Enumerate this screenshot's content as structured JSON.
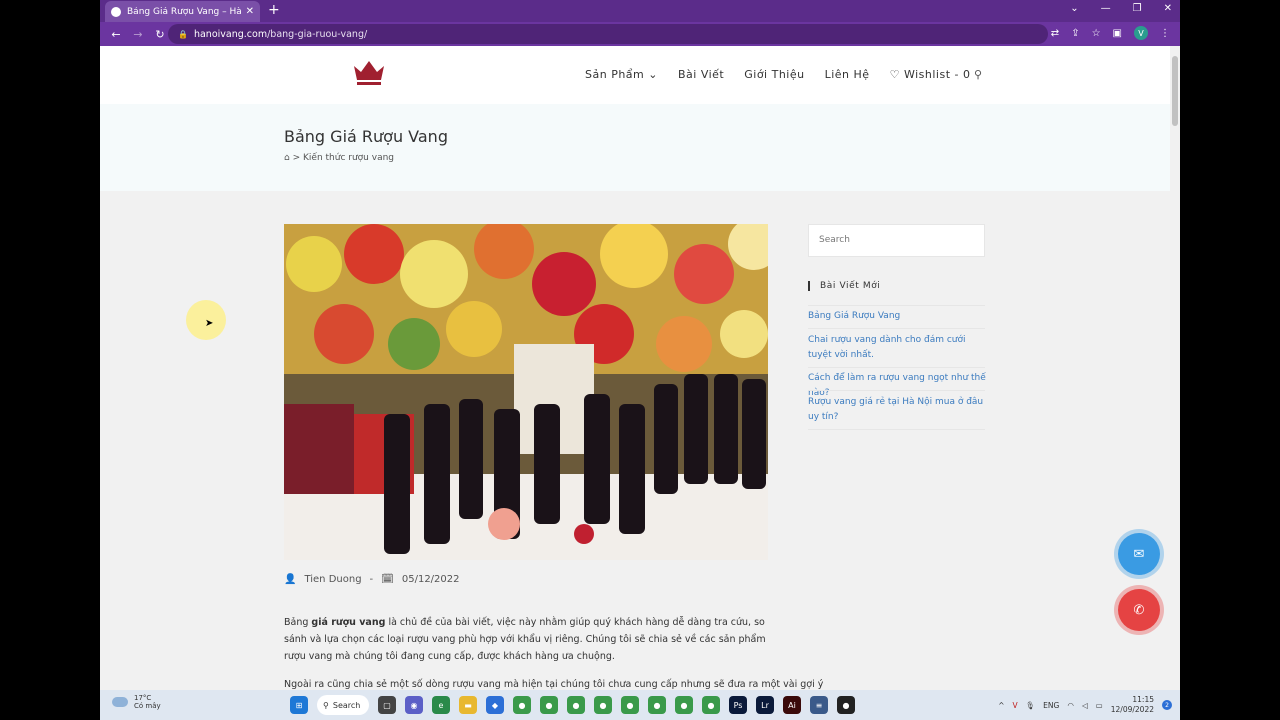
{
  "browser": {
    "tab_title": "Bảng Giá Rượu Vang – Hà Nội Vang",
    "url_host": "hanoivang.com",
    "url_path": "/bang-gia-ruou-vang/",
    "profile_initial": "V"
  },
  "nav": {
    "products": "Sản Phẩm",
    "posts": "Bài Viết",
    "about": "Giới Thiệu",
    "contact": "Liên Hệ",
    "wishlist": "Wishlist - 0"
  },
  "page": {
    "title": "Bảng Giá Rượu Vang",
    "breadcrumb_sep": ">",
    "breadcrumb_item": "Kiến thức rượu vang"
  },
  "post": {
    "author": "Tien Duong",
    "date": "05/12/2022",
    "p1_pre": "Bảng ",
    "p1_bold": "giá rượu vang",
    "p1_post": " là chủ đề của bài viết, việc này nhằm giúp quý khách hàng dễ dàng tra cứu, so sánh và lựa chọn các loại rượu vang phù hợp với khẩu vị riêng. Chúng tôi sẽ chia sẻ về các sản phẩm rượu vang mà chúng tôi đang cung cấp, được khách hàng ưa chuộng.",
    "p2": "Ngoài ra cũng chia sẻ một số dòng rượu vang mà hiện tại chúng tôi chưa cung cấp nhưng sẽ đưa ra một vài gợi ý"
  },
  "sidebar": {
    "search_placeholder": "Search",
    "recent_heading": "Bài Viết Mới",
    "recent_posts": [
      "Bảng Giá Rượu Vang",
      "Chai rượu vang dành cho đám cưới tuyệt vời nhất.",
      "Cách để làm ra rượu vang ngọt như thế nào?",
      "Rượu vang giá rẻ tại Hà Nội mua ở đâu uy tín?"
    ]
  },
  "taskbar": {
    "temp": "17°C",
    "weather": "Có mây",
    "search": "Search",
    "lang": "ENG",
    "time": "11:15",
    "date": "12/09/2022",
    "notif_count": "2"
  }
}
